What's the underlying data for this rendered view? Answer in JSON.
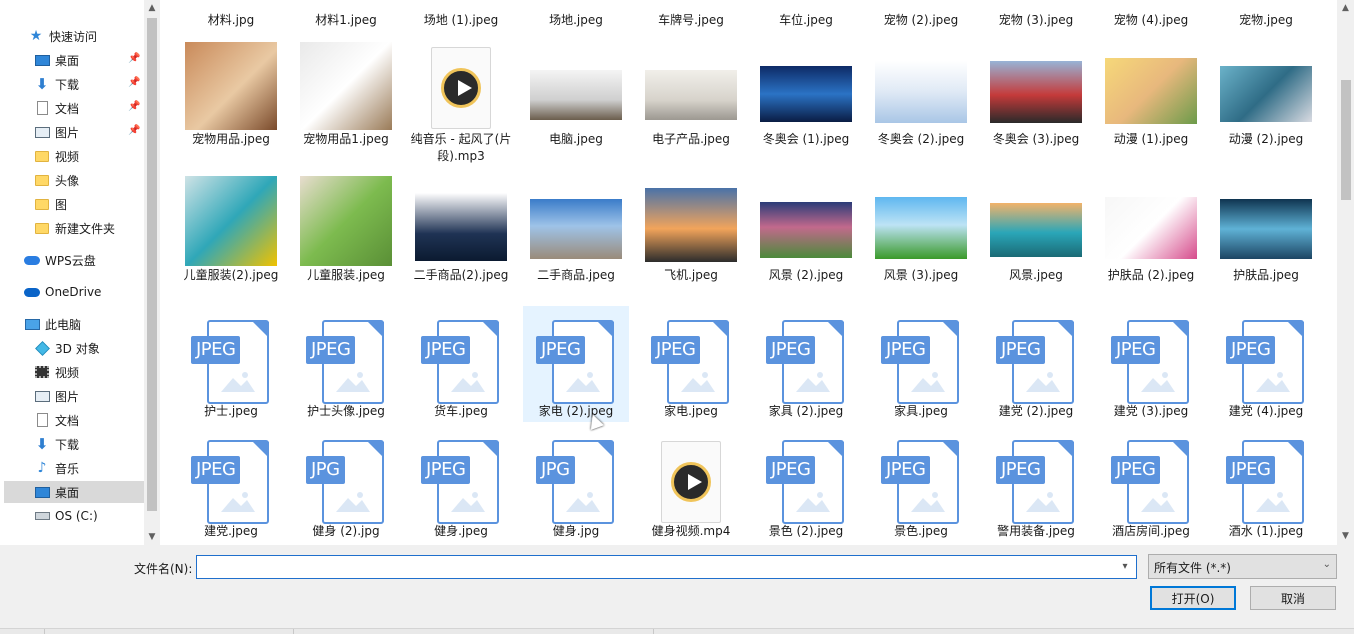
{
  "nav": {
    "quick_access": "快速访问",
    "items_quick": [
      {
        "label": "桌面",
        "icon": "desktop-icon",
        "pinned": true
      },
      {
        "label": "下载",
        "icon": "download-icon",
        "pinned": true
      },
      {
        "label": "文档",
        "icon": "document-icon",
        "pinned": true
      },
      {
        "label": "图片",
        "icon": "pictures-icon",
        "pinned": true
      },
      {
        "label": "视频",
        "icon": "folder-icon"
      },
      {
        "label": "头像",
        "icon": "folder-icon"
      },
      {
        "label": "图",
        "icon": "folder-icon"
      },
      {
        "label": "新建文件夹",
        "icon": "folder-icon"
      }
    ],
    "wps": "WPS云盘",
    "onedrive": "OneDrive",
    "this_pc": "此电脑",
    "items_pc": [
      {
        "label": "3D 对象",
        "icon": "3d-objects-icon"
      },
      {
        "label": "视频",
        "icon": "videos-icon"
      },
      {
        "label": "图片",
        "icon": "pictures-icon"
      },
      {
        "label": "文档",
        "icon": "document-icon"
      },
      {
        "label": "下载",
        "icon": "download-icon"
      },
      {
        "label": "音乐",
        "icon": "music-icon"
      },
      {
        "label": "桌面",
        "icon": "desktop-icon",
        "selected": true
      },
      {
        "label": "OS (C:)",
        "icon": "drive-icon"
      }
    ]
  },
  "files": {
    "row0": [
      "材料.jpg",
      "材料1.jpeg",
      "场地 (1).jpeg",
      "场地.jpeg",
      "车牌号.jpeg",
      "车位.jpeg",
      "宠物 (2).jpeg",
      "宠物 (3).jpeg",
      "宠物 (4).jpeg",
      "宠物.jpeg"
    ],
    "row1": [
      "宠物用品.jpeg",
      "宠物用品1.jpeg",
      "纯音乐 - 起风了(片段).mp3",
      "电脑.jpeg",
      "电子产品.jpeg",
      "冬奥会 (1).jpeg",
      "冬奥会 (2).jpeg",
      "冬奥会 (3).jpeg",
      "动漫 (1).jpeg",
      "动漫 (2).jpeg"
    ],
    "row2": [
      "儿童服装(2).jpeg",
      "儿童服装.jpeg",
      "二手商品(2).jpeg",
      "二手商品.jpeg",
      "飞机.jpeg",
      "风景 (2).jpeg",
      "风景 (3).jpeg",
      "风景.jpeg",
      "护肤品 (2).jpeg",
      "护肤品.jpeg"
    ],
    "row3": [
      "护士.jpeg",
      "护士头像.jpeg",
      "货车.jpeg",
      "家电 (2).jpeg",
      "家电.jpeg",
      "家具 (2).jpeg",
      "家具.jpeg",
      "建党 (2).jpeg",
      "建党 (3).jpeg",
      "建党 (4).jpeg"
    ],
    "row4": [
      "建党.jpeg",
      "健身 (2).jpg",
      "健身.jpeg",
      "健身.jpg",
      "健身视频.mp4",
      "景色 (2).jpeg",
      "景色.jpeg",
      "警用装备.jpeg",
      "酒店房间.jpeg",
      "酒水 (1).jpeg"
    ],
    "row3_tags": [
      "JPEG",
      "JPEG",
      "JPEG",
      "JPEG",
      "JPEG",
      "JPEG",
      "JPEG",
      "JPEG",
      "JPEG",
      "JPEG"
    ],
    "row4_tags": [
      "JPEG",
      "JPG",
      "JPEG",
      "JPG",
      "",
      "JPEG",
      "JPEG",
      "JPEG",
      "JPEG",
      "JPEG"
    ],
    "selected": "家电 (2).jpeg"
  },
  "bottom": {
    "filename_label": "文件名(N):",
    "filename_value": "",
    "filetype_value": "所有文件 (*.*)",
    "open_button": "打开(O)",
    "cancel_button": "取消"
  }
}
